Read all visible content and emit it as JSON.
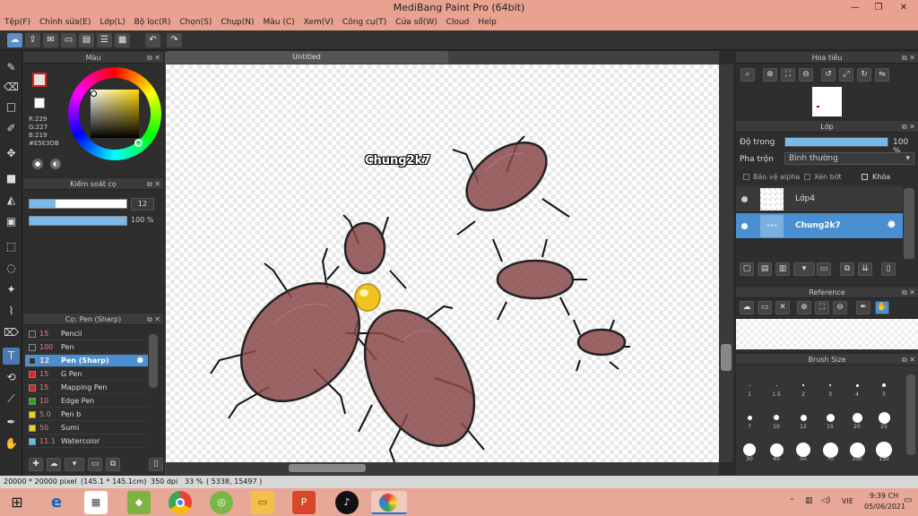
{
  "window": {
    "title": "MediBang Paint Pro (64bit)"
  },
  "menu": [
    "Tệp(F)",
    "Chỉnh sửa(E)",
    "Lớp(L)",
    "Bộ lọc(R)",
    "Chọn(S)",
    "Chụp(N)",
    "Màu (C)",
    "Xem(V)",
    "Công cụ(T)",
    "Cửa sổ(W)",
    "Cloud",
    "Help"
  ],
  "color_panel": {
    "title": "Màu",
    "r": "R:229",
    "g": "G:227",
    "b": "B:219",
    "hex": "#E5E3DB",
    "primary": "#e5e3db",
    "secondary": "#ffffff"
  },
  "brush_control": {
    "title": "Kiểm soát cọ",
    "size": "12",
    "opacity": "100 %",
    "size_fraction": 0.12,
    "opacity_fraction": 1.0
  },
  "brush_panel": {
    "title": "Cọ: Pen (Sharp)",
    "brushes": [
      {
        "size": "15",
        "name": "Pencil",
        "color": "#333333"
      },
      {
        "size": "100",
        "name": "Pen",
        "color": "#333333"
      },
      {
        "size": "12",
        "name": "Pen (Sharp)",
        "color": "#333333"
      },
      {
        "size": "15",
        "name": "G Pen",
        "color": "#e22020"
      },
      {
        "size": "15",
        "name": "Mapping Pen",
        "color": "#e22020"
      },
      {
        "size": "10",
        "name": "Edge Pen",
        "color": "#22aa22"
      },
      {
        "size": "5.0",
        "name": "Pen b",
        "color": "#e8d020"
      },
      {
        "size": "50",
        "name": "Sumi",
        "color": "#e8d020"
      },
      {
        "size": "11.1",
        "name": "Watercolor",
        "color": "#5bc0f0"
      }
    ]
  },
  "canvas": {
    "tab": "Untitled",
    "label": "Chung2k7"
  },
  "navigator": {
    "title": "Hoa tiêu"
  },
  "layers": {
    "title": "Lớp",
    "opacity_label": "Độ trong",
    "opacity_value": "100 %",
    "blend_label": "Pha trộn",
    "blend_value": "Bình thường",
    "protect_alpha": "Bảo vệ alpha",
    "clipping": "Xén bớt",
    "lock": "Khóa",
    "items": [
      {
        "name": "Lớp4",
        "selected": false
      },
      {
        "name": "Chung2k7",
        "selected": true
      }
    ]
  },
  "reference": {
    "title": "Reference"
  },
  "brush_size": {
    "title": "Brush Size",
    "rows": [
      [
        "1",
        "1.5",
        "2",
        "3",
        "4",
        "5"
      ],
      [
        "7",
        "10",
        "12",
        "15",
        "20",
        "25"
      ],
      [
        "30",
        "40",
        "50",
        "70",
        "100",
        "150"
      ]
    ]
  },
  "status": {
    "dimensions": "20000 * 20000 pixel",
    "size_cm": "(145.1 * 145.1cm)",
    "dpi": "350 dpi",
    "zoom": "33 %",
    "coords": "( 5338, 15497 )"
  },
  "taskbar": {
    "lang": "VIE",
    "time": "9:39 CH",
    "date": "05/06/2021"
  }
}
